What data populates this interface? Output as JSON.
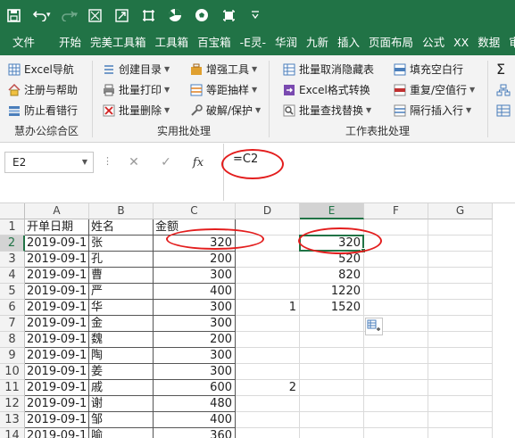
{
  "qat": {
    "icons": [
      "save-icon",
      "undo-icon",
      "redo-icon",
      "format-painter-icon",
      "select-icon",
      "crop-icon",
      "chart-icon",
      "football-icon",
      "square-icon",
      "customize-icon"
    ]
  },
  "tabs": [
    "文件",
    "开始",
    "完美工具箱",
    "工具箱",
    "百宝箱",
    "-E灵-",
    "华润",
    "九新",
    "插入",
    "页面布局",
    "公式",
    "XX",
    "数据",
    "审"
  ],
  "ribbon": {
    "group1": {
      "items": [
        "Excel导航",
        "注册与帮助",
        "防止看错行"
      ],
      "label": "慧办公综合区"
    },
    "group2": {
      "col1": [
        "创建目录",
        "批量打印",
        "批量删除"
      ],
      "col2": [
        "增强工具",
        "等距抽样",
        "破解/保护"
      ],
      "label": "实用批处理"
    },
    "group3": {
      "col1": [
        "批量取消隐藏表",
        "Excel格式转换",
        "批量查找替换"
      ],
      "col2": [
        "填充空白行",
        "重复/空值行",
        "隔行插入行"
      ],
      "label": "工作表批处理"
    },
    "group4": {
      "items": [
        "Σ"
      ]
    }
  },
  "formula_bar": {
    "name_box": "E2",
    "fx": "fx",
    "formula": "=C2"
  },
  "sheet": {
    "columns": [
      "A",
      "B",
      "C",
      "D",
      "E",
      "F",
      "G"
    ],
    "rows": [
      "1",
      "2",
      "3",
      "4",
      "5",
      "6",
      "7",
      "8",
      "9",
      "10",
      "11",
      "12",
      "13",
      "14"
    ],
    "cells": {
      "A": [
        "开单日期",
        "2019-09-1",
        "2019-09-1",
        "2019-09-1",
        "2019-09-1",
        "2019-09-1",
        "2019-09-1",
        "2019-09-1",
        "2019-09-1",
        "2019-09-1",
        "2019-09-1",
        "2019-09-1",
        "2019-09-1",
        "2019-09-1"
      ],
      "B": [
        "姓名",
        "张",
        "孔",
        "曹",
        "严",
        "华",
        "金",
        "魏",
        "陶",
        "姜",
        "戚",
        "谢",
        "邹",
        "喻"
      ],
      "C": [
        "金额",
        "320",
        "200",
        "300",
        "400",
        "300",
        "300",
        "200",
        "300",
        "300",
        "600",
        "480",
        "400",
        "360"
      ],
      "D": [
        "",
        "",
        "",
        "",
        "",
        "1",
        "",
        "",
        "",
        "",
        "2",
        "",
        "",
        ""
      ],
      "E": [
        "",
        "320",
        "520",
        "820",
        "1220",
        "1520",
        "",
        "",
        "",
        "",
        "",
        "",
        "",
        ""
      ]
    },
    "active_cell": "E2"
  },
  "colors": {
    "accent": "#217346",
    "annotation": "#e31e1e"
  }
}
